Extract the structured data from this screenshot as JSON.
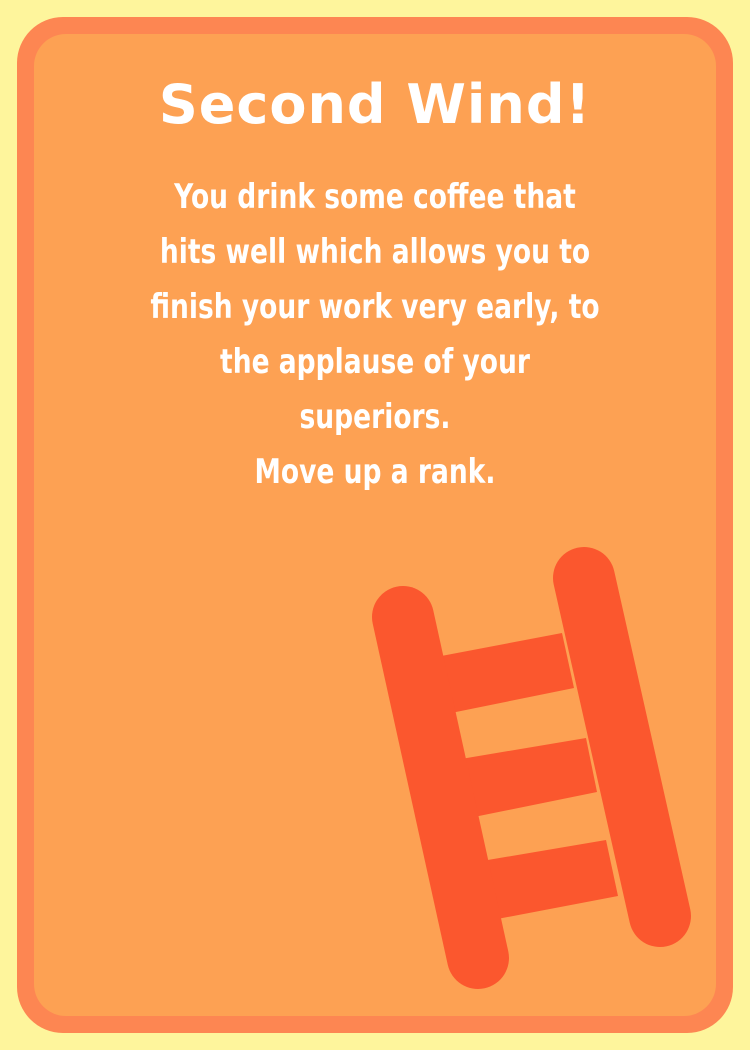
{
  "card": {
    "title": "Second Wind!",
    "description": "You drink some coffee that hits well which allows you to finish your work very early, to the applause of your superiors.",
    "action": "Move up a rank.",
    "illustration_icon": "ladder-icon"
  },
  "colors": {
    "background": "#fef59c",
    "card_border": "#fd8652",
    "card_fill": "#fda153",
    "ladder": "#fb572e",
    "text": "#ffffff"
  }
}
